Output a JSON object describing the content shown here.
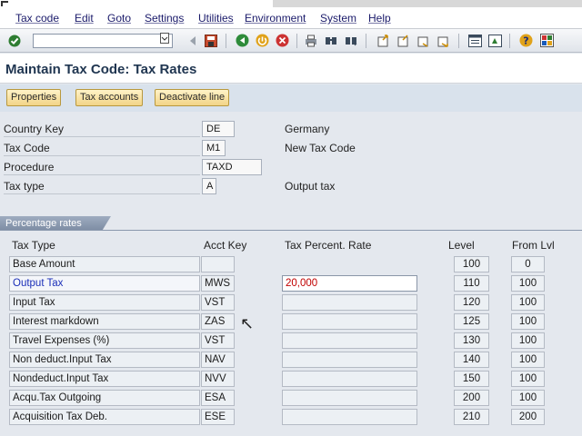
{
  "menu": {
    "items": [
      "Tax code",
      "Edit",
      "Goto",
      "Settings",
      "Utilities",
      "Environment",
      "System",
      "Help"
    ]
  },
  "toolbar": {
    "command_value": "",
    "icons": [
      "enter-icon",
      "command-field",
      "back-icon",
      "save-icon",
      "back-arrow-icon",
      "exit-icon",
      "cancel-icon",
      "print-icon",
      "find-icon",
      "find-next-icon",
      "first-page-icon",
      "previous-page-icon",
      "next-page-icon",
      "last-page-icon",
      "new-session-icon",
      "shortcut-icon",
      "help-icon",
      "layout-menu-icon"
    ]
  },
  "title": "Maintain Tax Code: Tax Rates",
  "app_toolbar": {
    "properties": "Properties",
    "tax_accounts": "Tax accounts",
    "deactivate_line": "Deactivate line"
  },
  "header": {
    "country_key_label": "Country Key",
    "country_key_value": "DE",
    "country_name": "Germany",
    "tax_code_label": "Tax Code",
    "tax_code_value": "M1",
    "tax_code_desc": "New Tax Code",
    "procedure_label": "Procedure",
    "procedure_value": "TAXD",
    "tax_type_label": "Tax type",
    "tax_type_value": "A",
    "tax_type_desc": "Output tax"
  },
  "rates": {
    "section_title": "Percentage rates",
    "columns": {
      "tax_type": "Tax Type",
      "acct_key": "Acct Key",
      "rate": "Tax Percent. Rate",
      "level": "Level",
      "from_lvl": "From Lvl"
    },
    "rows": [
      {
        "tax_type": "Base Amount",
        "acct_key": "",
        "rate": "",
        "level": "100",
        "from_lvl": "0"
      },
      {
        "tax_type": "Output Tax",
        "acct_key": "MWS",
        "rate": "20,000",
        "level": "110",
        "from_lvl": "100"
      },
      {
        "tax_type": "Input Tax",
        "acct_key": "VST",
        "rate": "",
        "level": "120",
        "from_lvl": "100"
      },
      {
        "tax_type": "Interest markdown",
        "acct_key": "ZAS",
        "rate": "",
        "level": "125",
        "from_lvl": "100"
      },
      {
        "tax_type": "Travel Expenses (%)",
        "acct_key": "VST",
        "rate": "",
        "level": "130",
        "from_lvl": "100"
      },
      {
        "tax_type": "Non deduct.Input Tax",
        "acct_key": "NAV",
        "rate": "",
        "level": "140",
        "from_lvl": "100"
      },
      {
        "tax_type": "Nondeduct.Input Tax",
        "acct_key": "NVV",
        "rate": "",
        "level": "150",
        "from_lvl": "100"
      },
      {
        "tax_type": "Acqu.Tax Outgoing",
        "acct_key": "ESA",
        "rate": "",
        "level": "200",
        "from_lvl": "100"
      },
      {
        "tax_type": "Acquisition Tax Deb.",
        "acct_key": "ESE",
        "rate": "",
        "level": "210",
        "from_lvl": "200"
      }
    ]
  },
  "colors": {
    "title": "#1f3550",
    "selected_text": "#1b2fb8",
    "rate_value": "#c00000",
    "button_fill": "#f2d487"
  }
}
